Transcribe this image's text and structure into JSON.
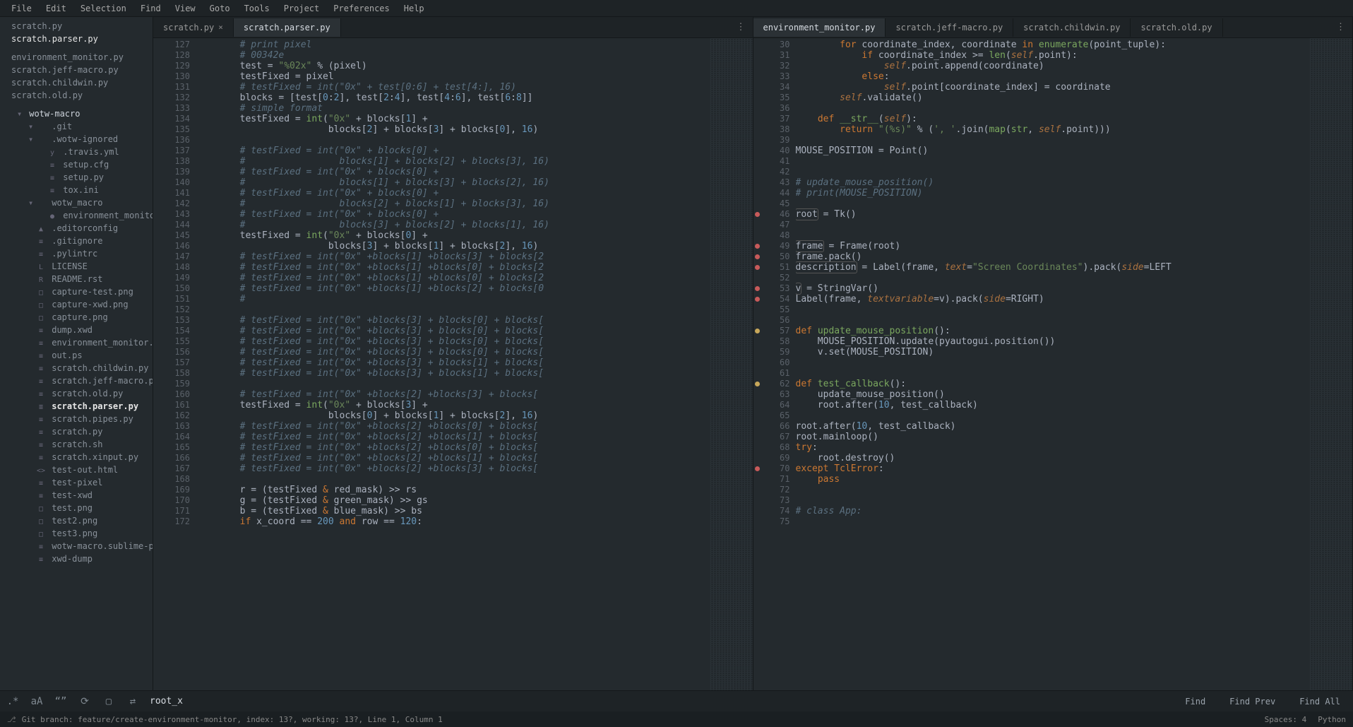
{
  "menu": [
    "File",
    "Edit",
    "Selection",
    "Find",
    "View",
    "Goto",
    "Tools",
    "Project",
    "Preferences",
    "Help"
  ],
  "sidebar": {
    "open_files": [
      {
        "name": "scratch.py",
        "active": false
      },
      {
        "name": "scratch.parser.py",
        "active": true
      }
    ],
    "other_open": [
      "environment_monitor.py",
      "scratch.jeff-macro.py",
      "scratch.childwin.py",
      "scratch.old.py"
    ],
    "project_root": "wotw-macro",
    "tree": [
      {
        "depth": 1,
        "arrow": "▾",
        "icon": "",
        "label": ".git"
      },
      {
        "depth": 1,
        "arrow": "▾",
        "icon": "",
        "label": ".wotw-ignored"
      },
      {
        "depth": 2,
        "arrow": "",
        "icon": "y",
        "label": ".travis.yml"
      },
      {
        "depth": 2,
        "arrow": "",
        "icon": "≡",
        "label": "setup.cfg"
      },
      {
        "depth": 2,
        "arrow": "",
        "icon": "≡",
        "label": "setup.py"
      },
      {
        "depth": 2,
        "arrow": "",
        "icon": "≡",
        "label": "tox.ini"
      },
      {
        "depth": 1,
        "arrow": "▾",
        "icon": "",
        "label": "wotw_macro"
      },
      {
        "depth": 2,
        "arrow": "",
        "icon": "●",
        "label": "environment_monitor.py"
      },
      {
        "depth": 0,
        "arrow": "",
        "icon": "▲",
        "label": ".editorconfig"
      },
      {
        "depth": 0,
        "arrow": "",
        "icon": "≡",
        "label": ".gitignore"
      },
      {
        "depth": 0,
        "arrow": "",
        "icon": "≡",
        "label": ".pylintrc"
      },
      {
        "depth": 0,
        "arrow": "",
        "icon": "L",
        "label": "LICENSE"
      },
      {
        "depth": 0,
        "arrow": "",
        "icon": "R",
        "label": "README.rst"
      },
      {
        "depth": 0,
        "arrow": "",
        "icon": "□",
        "label": "capture-test.png"
      },
      {
        "depth": 0,
        "arrow": "",
        "icon": "□",
        "label": "capture-xwd.png"
      },
      {
        "depth": 0,
        "arrow": "",
        "icon": "□",
        "label": "capture.png"
      },
      {
        "depth": 0,
        "arrow": "",
        "icon": "≡",
        "label": "dump.xwd"
      },
      {
        "depth": 0,
        "arrow": "",
        "icon": "≡",
        "label": "environment_monitor.py"
      },
      {
        "depth": 0,
        "arrow": "",
        "icon": "≡",
        "label": "out.ps"
      },
      {
        "depth": 0,
        "arrow": "",
        "icon": "≡",
        "label": "scratch.childwin.py"
      },
      {
        "depth": 0,
        "arrow": "",
        "icon": "≡",
        "label": "scratch.jeff-macro.py"
      },
      {
        "depth": 0,
        "arrow": "",
        "icon": "≡",
        "label": "scratch.old.py"
      },
      {
        "depth": 0,
        "arrow": "",
        "icon": "≡",
        "label": "scratch.parser.py",
        "bold": true
      },
      {
        "depth": 0,
        "arrow": "",
        "icon": "≡",
        "label": "scratch.pipes.py"
      },
      {
        "depth": 0,
        "arrow": "",
        "icon": "≡",
        "label": "scratch.py"
      },
      {
        "depth": 0,
        "arrow": "",
        "icon": "≡",
        "label": "scratch.sh"
      },
      {
        "depth": 0,
        "arrow": "",
        "icon": "≡",
        "label": "scratch.xinput.py"
      },
      {
        "depth": 0,
        "arrow": "",
        "icon": "<>",
        "label": "test-out.html"
      },
      {
        "depth": 0,
        "arrow": "",
        "icon": "≡",
        "label": "test-pixel"
      },
      {
        "depth": 0,
        "arrow": "",
        "icon": "≡",
        "label": "test-xwd"
      },
      {
        "depth": 0,
        "arrow": "",
        "icon": "□",
        "label": "test.png"
      },
      {
        "depth": 0,
        "arrow": "",
        "icon": "□",
        "label": "test2.png"
      },
      {
        "depth": 0,
        "arrow": "",
        "icon": "□",
        "label": "test3.png"
      },
      {
        "depth": 0,
        "arrow": "",
        "icon": "≡",
        "label": "wotw-macro.sublime-project"
      },
      {
        "depth": 0,
        "arrow": "",
        "icon": "≡",
        "label": "xwd-dump"
      }
    ]
  },
  "left_pane": {
    "tabs": [
      {
        "label": "scratch.py",
        "close": true,
        "active": false
      },
      {
        "label": "scratch.parser.py",
        "close": false,
        "active": true
      }
    ],
    "first_line": 127,
    "lines": [
      {
        "t": "comment",
        "text": "        # print pixel"
      },
      {
        "t": "comment",
        "text": "        # 00342e"
      },
      {
        "t": "code",
        "html": "        test = <span class='c-s'>\"%02x\"</span> <span class='c-p'>%</span> (pixel)"
      },
      {
        "t": "code",
        "html": "        testFixed = pixel"
      },
      {
        "t": "comment",
        "text": "        # testFixed = int(\"0x\" + test[0:6] + test[4:], 16)"
      },
      {
        "t": "code",
        "html": "        blocks = [test[<span class='c-n'>0</span>:<span class='c-n'>2</span>], test[<span class='c-n'>2</span>:<span class='c-n'>4</span>], test[<span class='c-n'>4</span>:<span class='c-n'>6</span>], test[<span class='c-n'>6</span>:<span class='c-n'>8</span>]]"
      },
      {
        "t": "comment",
        "text": "        # simple format"
      },
      {
        "t": "code",
        "html": "        testFixed = <span class='c-fn'>int</span>(<span class='c-s'>\"0x\"</span> + blocks[<span class='c-n'>1</span>] +"
      },
      {
        "t": "code",
        "html": "                        blocks[<span class='c-n'>2</span>] + blocks[<span class='c-n'>3</span>] + blocks[<span class='c-n'>0</span>], <span class='c-n'>16</span>)"
      },
      {
        "t": "blank",
        "text": ""
      },
      {
        "t": "comment",
        "text": "        # testFixed = int(\"0x\" + blocks[0] +"
      },
      {
        "t": "comment",
        "text": "        #                 blocks[1] + blocks[2] + blocks[3], 16)"
      },
      {
        "t": "comment",
        "text": "        # testFixed = int(\"0x\" + blocks[0] +"
      },
      {
        "t": "comment",
        "text": "        #                 blocks[1] + blocks[3] + blocks[2], 16)"
      },
      {
        "t": "comment",
        "text": "        # testFixed = int(\"0x\" + blocks[0] +"
      },
      {
        "t": "comment",
        "text": "        #                 blocks[2] + blocks[1] + blocks[3], 16)"
      },
      {
        "t": "comment",
        "text": "        # testFixed = int(\"0x\" + blocks[0] +"
      },
      {
        "t": "comment",
        "text": "        #                 blocks[3] + blocks[2] + blocks[1], 16)"
      },
      {
        "t": "code",
        "html": "        testFixed = <span class='c-fn'>int</span>(<span class='c-s'>\"0x\"</span> + blocks[<span class='c-n'>0</span>] +"
      },
      {
        "t": "code",
        "html": "                        blocks[<span class='c-n'>3</span>] + blocks[<span class='c-n'>1</span>] + blocks[<span class='c-n'>2</span>], <span class='c-n'>16</span>)"
      },
      {
        "t": "comment",
        "text": "        # testFixed = int(\"0x\" +blocks[1] +blocks[3] + blocks[2"
      },
      {
        "t": "comment",
        "text": "        # testFixed = int(\"0x\" +blocks[1] +blocks[0] + blocks[2"
      },
      {
        "t": "comment",
        "text": "        # testFixed = int(\"0x\" +blocks[1] +blocks[0] + blocks[2"
      },
      {
        "t": "comment",
        "text": "        # testFixed = int(\"0x\" +blocks[1] +blocks[2] + blocks[0"
      },
      {
        "t": "comment",
        "text": "        #"
      },
      {
        "t": "blank",
        "text": ""
      },
      {
        "t": "comment",
        "text": "        # testFixed = int(\"0x\" +blocks[3] + blocks[0] + blocks["
      },
      {
        "t": "comment",
        "text": "        # testFixed = int(\"0x\" +blocks[3] + blocks[0] + blocks["
      },
      {
        "t": "comment",
        "text": "        # testFixed = int(\"0x\" +blocks[3] + blocks[0] + blocks["
      },
      {
        "t": "comment",
        "text": "        # testFixed = int(\"0x\" +blocks[3] + blocks[0] + blocks["
      },
      {
        "t": "comment",
        "text": "        # testFixed = int(\"0x\" +blocks[3] + blocks[1] + blocks["
      },
      {
        "t": "comment",
        "text": "        # testFixed = int(\"0x\" +blocks[3] + blocks[1] + blocks["
      },
      {
        "t": "blank",
        "text": ""
      },
      {
        "t": "comment",
        "text": "        # testFixed = int(\"0x\" +blocks[2] +blocks[3] + blocks["
      },
      {
        "t": "code",
        "html": "        testFixed = <span class='c-fn'>int</span>(<span class='c-s'>\"0x\"</span> + blocks[<span class='c-n'>3</span>] +"
      },
      {
        "t": "code",
        "html": "                        blocks[<span class='c-n'>0</span>] + blocks[<span class='c-n'>1</span>] + blocks[<span class='c-n'>2</span>], <span class='c-n'>16</span>)"
      },
      {
        "t": "comment",
        "text": "        # testFixed = int(\"0x\" +blocks[2] +blocks[0] + blocks["
      },
      {
        "t": "comment",
        "text": "        # testFixed = int(\"0x\" +blocks[2] +blocks[1] + blocks["
      },
      {
        "t": "comment",
        "text": "        # testFixed = int(\"0x\" +blocks[2] +blocks[0] + blocks["
      },
      {
        "t": "comment",
        "text": "        # testFixed = int(\"0x\" +blocks[2] +blocks[1] + blocks["
      },
      {
        "t": "comment",
        "text": "        # testFixed = int(\"0x\" +blocks[2] +blocks[3] + blocks["
      },
      {
        "t": "blank",
        "text": ""
      },
      {
        "t": "code",
        "html": "        r = (testFixed <span class='c-k'>&amp;</span> red_mask) <span class='c-p'>&gt;&gt;</span> rs"
      },
      {
        "t": "code",
        "html": "        g = (testFixed <span class='c-k'>&amp;</span> green_mask) <span class='c-p'>&gt;&gt;</span> gs"
      },
      {
        "t": "code",
        "html": "        b = (testFixed <span class='c-k'>&amp;</span> blue_mask) <span class='c-p'>&gt;&gt;</span> bs"
      },
      {
        "t": "code",
        "html": "        <span class='c-k'>if</span> x_coord <span class='c-p'>==</span> <span class='c-n'>200</span> <span class='c-k'>and</span> row <span class='c-p'>==</span> <span class='c-n'>120</span>:"
      }
    ]
  },
  "right_pane": {
    "tabs": [
      {
        "label": "environment_monitor.py",
        "active": true
      },
      {
        "label": "scratch.jeff-macro.py",
        "active": false
      },
      {
        "label": "scratch.childwin.py",
        "active": false
      },
      {
        "label": "scratch.old.py",
        "active": false
      }
    ],
    "first_line": 30,
    "marks": {
      "46": "red",
      "49": "red",
      "50": "red",
      "51": "red",
      "53": "red",
      "54": "red",
      "57": "yellow",
      "62": "yellow",
      "70": "red"
    },
    "lines": [
      {
        "t": "code",
        "html": "        <span class='c-k'>for</span> coordinate_index, coordinate <span class='c-k'>in</span> <span class='c-fn'>enumerate</span>(point_tuple):"
      },
      {
        "t": "code",
        "html": "            <span class='c-k'>if</span> coordinate_index &gt;= <span class='c-fn'>len</span>(<span class='c-self'>self</span>.point):"
      },
      {
        "t": "code",
        "html": "                <span class='c-self'>self</span>.point.append(coordinate)"
      },
      {
        "t": "code",
        "html": "            <span class='c-k'>else</span>:"
      },
      {
        "t": "code",
        "html": "                <span class='c-self'>self</span>.point[coordinate_index] = coordinate"
      },
      {
        "t": "code",
        "html": "        <span class='c-self'>self</span>.validate()"
      },
      {
        "t": "blank",
        "text": ""
      },
      {
        "t": "code",
        "html": "    <span class='c-k'>def</span> <span class='c-fn'>__str__</span>(<span class='c-self'>self</span>):"
      },
      {
        "t": "code",
        "html": "        <span class='c-k'>return</span> <span class='c-s'>\"(%s)\"</span> % (<span class='c-s'>', '</span>.join(<span class='c-fn'>map</span>(<span class='c-fn'>str</span>, <span class='c-self'>self</span>.point)))"
      },
      {
        "t": "blank",
        "text": ""
      },
      {
        "t": "code",
        "html": "MOUSE_POSITION = Point()"
      },
      {
        "t": "blank",
        "text": ""
      },
      {
        "t": "blank",
        "text": ""
      },
      {
        "t": "comment",
        "text": "# update_mouse_position()"
      },
      {
        "t": "comment",
        "text": "# print(MOUSE_POSITION)"
      },
      {
        "t": "blank",
        "text": ""
      },
      {
        "t": "code",
        "html": "<span class='c-hl'>root</span> = Tk()"
      },
      {
        "t": "blank",
        "text": ""
      },
      {
        "t": "blank",
        "text": ""
      },
      {
        "t": "code",
        "html": "<span class='c-hl'>frame</span> = Frame(root)"
      },
      {
        "t": "code",
        "html": "frame.pack()"
      },
      {
        "t": "code",
        "html": "<span class='c-hl'>description</span> = Label(frame, <span class='c-self'>text</span>=<span class='c-s'>\"Screen Coordinates\"</span>).pack(<span class='c-self'>side</span>=LEFT"
      },
      {
        "t": "blank",
        "text": ""
      },
      {
        "t": "code",
        "html": "<span class='c-hl'>v</span> = StringVar()"
      },
      {
        "t": "code",
        "html": "Label(frame, <span class='c-self'>textvariable</span>=v).pack(<span class='c-self'>side</span>=RIGHT)"
      },
      {
        "t": "blank",
        "text": ""
      },
      {
        "t": "blank",
        "text": ""
      },
      {
        "t": "code",
        "html": "<span class='c-k'>def</span> <span class='c-fn'>update_mouse_position</span>():"
      },
      {
        "t": "code",
        "html": "    MOUSE_POSITION.update(pyautogui.position())"
      },
      {
        "t": "code",
        "html": "    v.set(MOUSE_POSITION)"
      },
      {
        "t": "blank",
        "text": ""
      },
      {
        "t": "blank",
        "text": ""
      },
      {
        "t": "code",
        "html": "<span class='c-k'>def</span> <span class='c-fn'>test_callback</span>():"
      },
      {
        "t": "code",
        "html": "    update_mouse_position()"
      },
      {
        "t": "code",
        "html": "    root.after(<span class='c-n'>10</span>, test_callback)"
      },
      {
        "t": "blank",
        "text": ""
      },
      {
        "t": "code",
        "html": "root.after(<span class='c-n'>10</span>, test_callback)"
      },
      {
        "t": "code",
        "html": "root.mainloop()"
      },
      {
        "t": "code",
        "html": "<span class='c-k'>try</span>:"
      },
      {
        "t": "code",
        "html": "    root.destroy()"
      },
      {
        "t": "code",
        "html": "<span class='c-k'>except</span> <span class='c-cls'>TclError</span>:"
      },
      {
        "t": "code",
        "html": "    <span class='c-k'>pass</span>"
      },
      {
        "t": "blank",
        "text": ""
      },
      {
        "t": "blank",
        "text": ""
      },
      {
        "t": "comment",
        "text": "# class App:"
      },
      {
        "t": "blank",
        "text": ""
      }
    ]
  },
  "find": {
    "regex_icon": ".*",
    "case_icon": "aA",
    "word_icon": "“”",
    "refresh_icon": "⟳",
    "wrap_icon": "▢",
    "inselection_icon": "⇄",
    "query": "root_x",
    "buttons": [
      "Find",
      "Find Prev",
      "Find All"
    ]
  },
  "status": {
    "left_icon": "⎇",
    "text": "Git branch: feature/create-environment-monitor, index: 13?, working: 13?, Line 1, Column 1",
    "spaces": "Spaces: 4",
    "lang": "Python"
  }
}
